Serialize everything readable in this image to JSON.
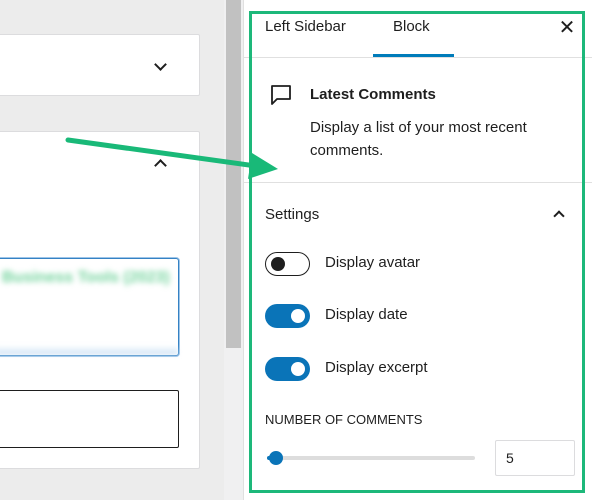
{
  "editor": {
    "blurred_heading": "Business Tools (2023)"
  },
  "sidebar": {
    "tabs": [
      {
        "label": "Left Sidebar",
        "active": false
      },
      {
        "label": "Block",
        "active": true
      }
    ],
    "close_icon": "close-icon",
    "close_glyph": "✕",
    "block": {
      "icon": "comment-icon",
      "title": "Latest Comments",
      "description": "Display a list of your most recent comments."
    },
    "settings": {
      "title": "Settings",
      "expanded": true,
      "toggles": [
        {
          "label": "Display avatar",
          "checked": false
        },
        {
          "label": "Display date",
          "checked": true
        },
        {
          "label": "Display excerpt",
          "checked": true
        }
      ],
      "number_of_comments": {
        "label": "NUMBER OF COMMENTS",
        "value": "5",
        "min": 1,
        "max": 100
      }
    }
  },
  "colors": {
    "accent": "#0a74b8",
    "highlight": "#1db87a",
    "arrow": "#19b978"
  }
}
